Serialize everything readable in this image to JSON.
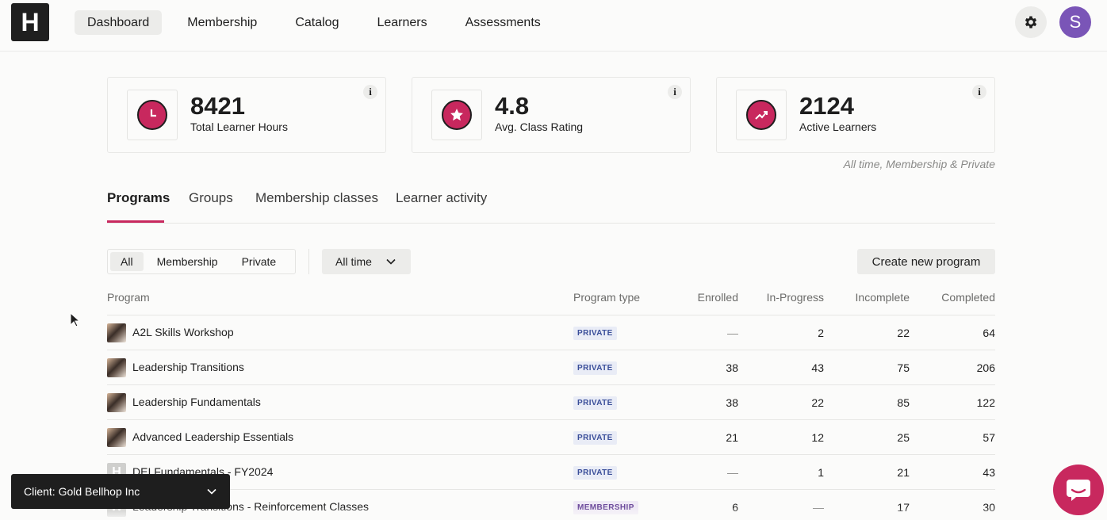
{
  "brand": {
    "logo_letter": "H",
    "accent": "#c8285e",
    "avatar_color": "#7a55b7"
  },
  "nav": {
    "items": [
      {
        "label": "Dashboard",
        "active": true
      },
      {
        "label": "Membership",
        "active": false
      },
      {
        "label": "Catalog",
        "active": false
      },
      {
        "label": "Learners",
        "active": false
      },
      {
        "label": "Assessments",
        "active": false
      }
    ],
    "avatar_initial": "S"
  },
  "stats": [
    {
      "value": "8421",
      "label": "Total Learner Hours",
      "icon": "clock-icon",
      "info": "i"
    },
    {
      "value": "4.8",
      "label": "Avg. Class Rating",
      "icon": "star-icon",
      "info": "i"
    },
    {
      "value": "2124",
      "label": "Active Learners",
      "icon": "trend-up-icon",
      "info": "i"
    }
  ],
  "stats_footnote": "All time, Membership & Private",
  "tabs": [
    {
      "label": "Programs",
      "active": true
    },
    {
      "label": "Groups",
      "active": false
    },
    {
      "label": "Membership classes",
      "active": false
    },
    {
      "label": "Learner activity",
      "active": false
    }
  ],
  "filters": {
    "segments": [
      {
        "label": "All",
        "active": true
      },
      {
        "label": "Membership",
        "active": false
      },
      {
        "label": "Private",
        "active": false
      }
    ],
    "time_range": "All time",
    "create_label": "Create new program"
  },
  "table": {
    "columns": [
      "Program",
      "Program type",
      "Enrolled",
      "In-Progress",
      "Incomplete",
      "Completed"
    ],
    "rows": [
      {
        "name": "A2L Skills Workshop",
        "type": "PRIVATE",
        "enrolled": "—",
        "in_progress": "2",
        "incomplete": "22",
        "completed": "64",
        "thumb": "photo"
      },
      {
        "name": "Leadership Transitions",
        "type": "PRIVATE",
        "enrolled": "38",
        "in_progress": "43",
        "incomplete": "75",
        "completed": "206",
        "thumb": "photo"
      },
      {
        "name": "Leadership Fundamentals",
        "type": "PRIVATE",
        "enrolled": "38",
        "in_progress": "22",
        "incomplete": "85",
        "completed": "122",
        "thumb": "photo"
      },
      {
        "name": "Advanced Leadership Essentials",
        "type": "PRIVATE",
        "enrolled": "21",
        "in_progress": "12",
        "incomplete": "25",
        "completed": "57",
        "thumb": "photo"
      },
      {
        "name": "DEI Fundamentals - FY2024",
        "type": "PRIVATE",
        "enrolled": "—",
        "in_progress": "1",
        "incomplete": "21",
        "completed": "43",
        "thumb": "logo"
      },
      {
        "name": "Leadership Transitions - Reinforcement Classes",
        "type": "MEMBERSHIP",
        "enrolled": "6",
        "in_progress": "—",
        "incomplete": "17",
        "completed": "30",
        "thumb": "logo"
      }
    ]
  },
  "client_selector": {
    "label": "Client: Gold Bellhop Inc"
  }
}
